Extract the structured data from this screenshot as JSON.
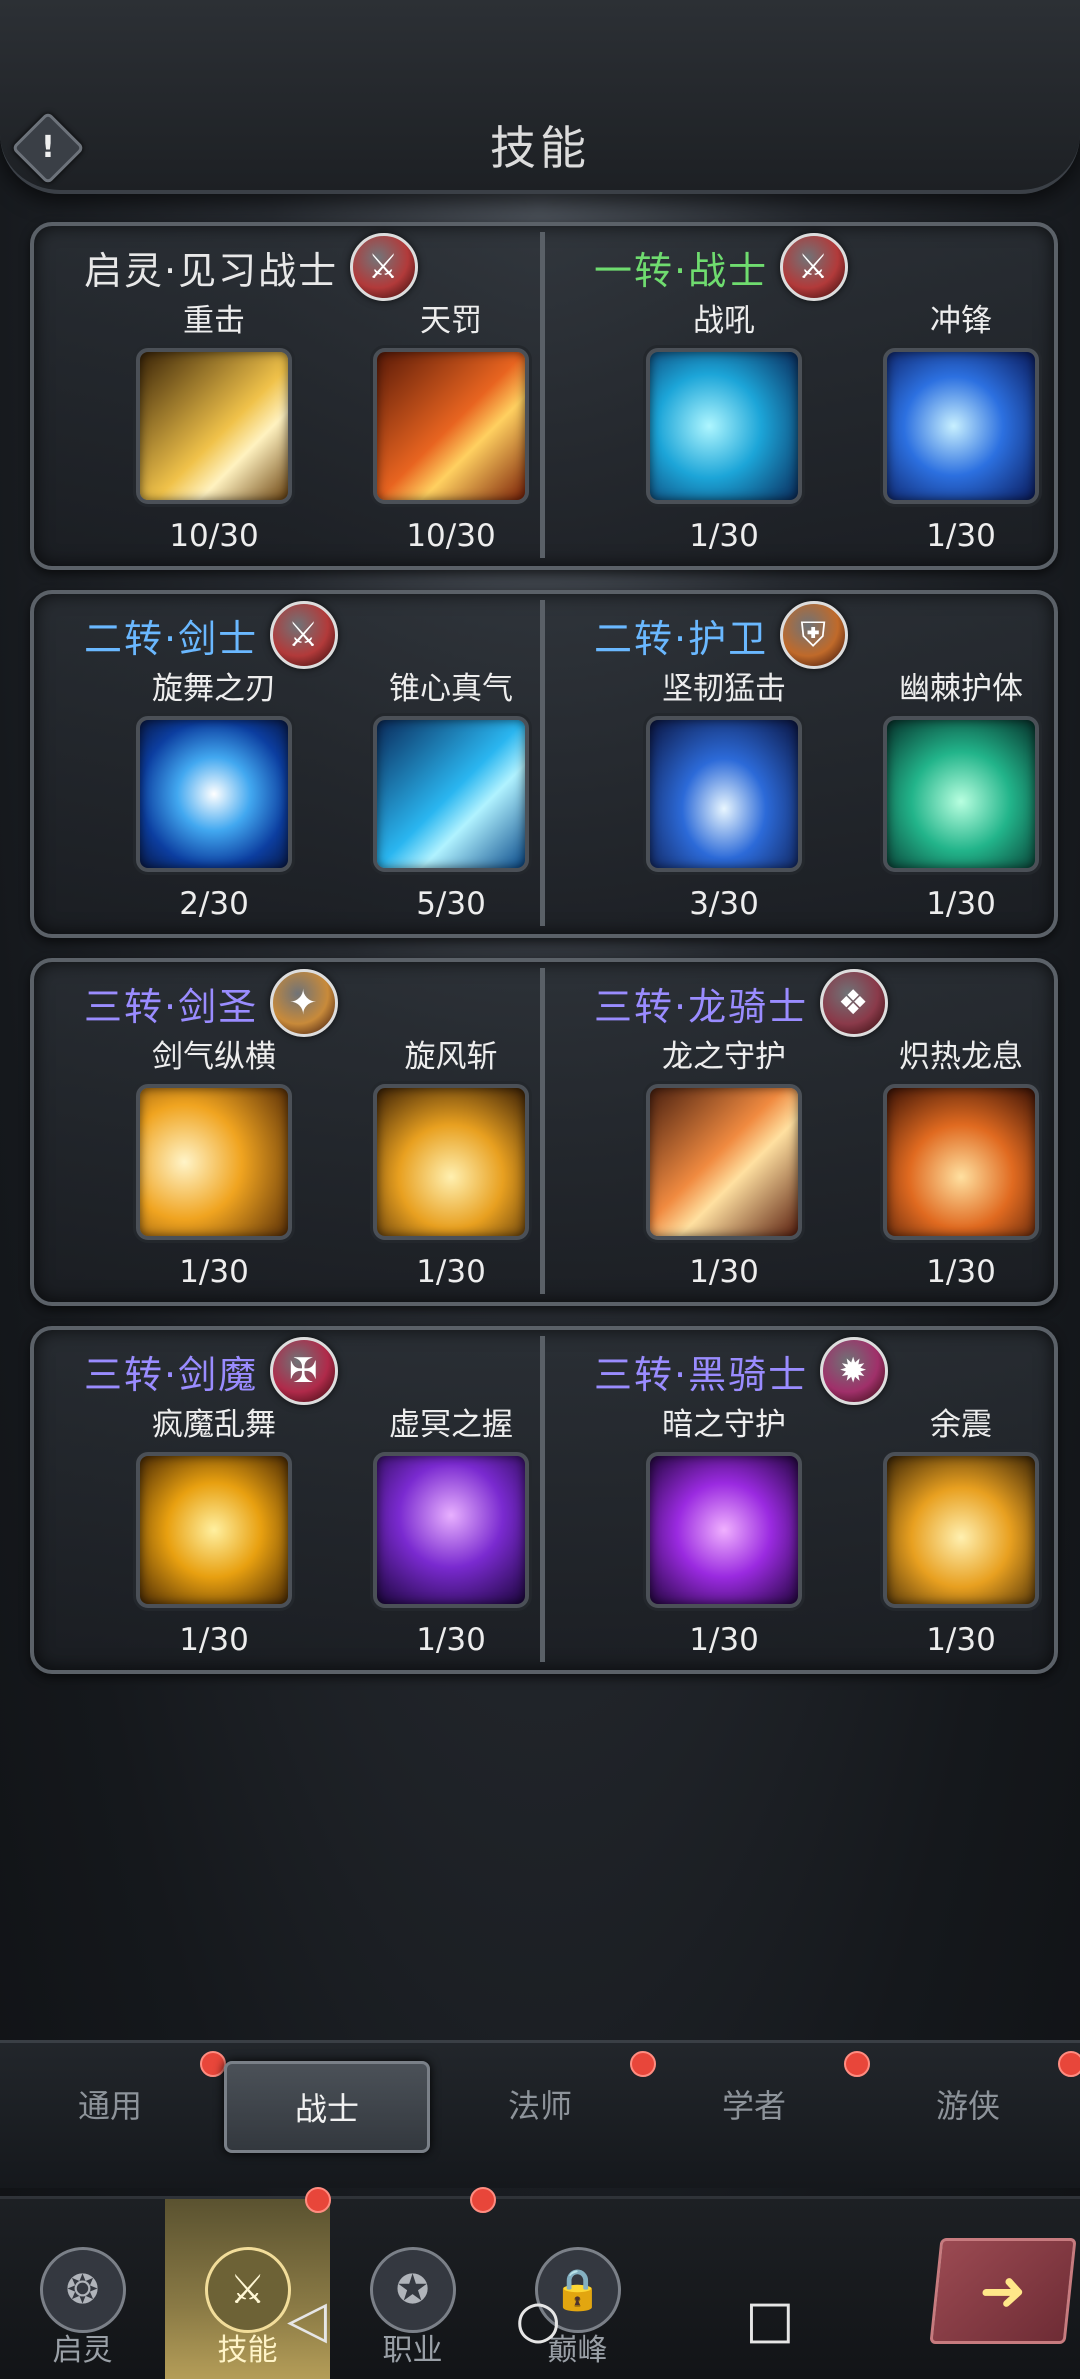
{
  "header": {
    "title": "技能",
    "info_icon": "!"
  },
  "panels": [
    {
      "left": {
        "title": "启灵·见习战士",
        "title_color": "#e8e8e8",
        "emblem": "sword-emblem-icon",
        "emblem_bg": "#b23a3a",
        "skills": [
          {
            "name": "重击",
            "level": "10/30",
            "gradient": "linear-gradient(135deg,#3a2408,#f0c24a 55%,#fff2c0 70%,#6b4310)"
          },
          {
            "name": "天罚",
            "level": "10/30",
            "gradient": "linear-gradient(135deg,#5a1a08,#e86420 50%,#ffd060 65%,#7a2008)"
          }
        ]
      },
      "right": {
        "title": "一转·战士",
        "title_color": "#6fdc6f",
        "emblem": "sword-emblem-icon",
        "emblem_bg": "#b23a3a",
        "skills": [
          {
            "name": "战吼",
            "level": "1/30",
            "gradient": "radial-gradient(circle at 40% 50%,#aef6ff,#1ca5d8 45%,#0a2a5a)"
          },
          {
            "name": "冲锋",
            "level": "1/30",
            "gradient": "radial-gradient(circle at 45% 50%,#c8f0ff,#2c70e0 45%,#0a1a5a)"
          }
        ]
      }
    },
    {
      "left": {
        "title": "二转·剑士",
        "title_color": "#6ab8ff",
        "emblem": "triple-sword-icon",
        "emblem_bg": "#b23a3a",
        "skills": [
          {
            "name": "旋舞之刃",
            "level": "2/30",
            "gradient": "radial-gradient(circle at 50% 50%,#ffffff,#42a8f0 35%,#0c3ea0 70%,#081a4a)"
          },
          {
            "name": "锥心真气",
            "level": "5/30",
            "gradient": "linear-gradient(135deg,#0a2a5a,#2ab6f0 50%,#b0f2ff 65%,#0a4a8a)"
          }
        ]
      },
      "right": {
        "title": "二转·护卫",
        "title_color": "#6ab8ff",
        "emblem": "shield-emblem-icon",
        "emblem_bg": "#c06a2a",
        "skills": [
          {
            "name": "坚韧猛击",
            "level": "3/30",
            "gradient": "radial-gradient(ellipse at 50% 60%,#e8f6ff,#2c6ad8 40%,#0a1440)"
          },
          {
            "name": "幽棘护体",
            "level": "1/30",
            "gradient": "radial-gradient(circle at 50% 55%,#b8ffe0,#22b48a 45%,#06302a)"
          }
        ]
      }
    },
    {
      "left": {
        "title": "三转·剑圣",
        "title_color": "#9a8cff",
        "emblem": "winged-sword-icon",
        "emblem_bg": "#c88a3a",
        "skills": [
          {
            "name": "剑气纵横",
            "level": "1/30",
            "gradient": "radial-gradient(circle at 30% 50%,#fff4c8,#f0a420 45%,#5a3008)"
          },
          {
            "name": "旋风斩",
            "level": "1/30",
            "gradient": "radial-gradient(circle at 50% 60%,#fff0b0,#e8a020 45%,#3a2006)"
          }
        ]
      },
      "right": {
        "title": "三转·龙骑士",
        "title_color": "#9a8cff",
        "emblem": "dragon-emblem-icon",
        "emblem_bg": "#8a3a4a",
        "skills": [
          {
            "name": "龙之守护",
            "level": "1/30",
            "gradient": "linear-gradient(135deg,#4a2010,#f08a40 45%,#ffe0a0 60%,#5a2010)"
          },
          {
            "name": "炽热龙息",
            "level": "1/30",
            "gradient": "radial-gradient(circle at 50% 60%,#ffe0a0,#e06a20 45%,#3a1206)"
          }
        ]
      }
    },
    {
      "left": {
        "title": "三转·剑魔",
        "title_color": "#9a8cff",
        "emblem": "cross-swords-icon",
        "emblem_bg": "#b02a4a",
        "skills": [
          {
            "name": "疯魔乱舞",
            "level": "1/30",
            "gradient": "radial-gradient(circle at 50% 50%,#fff0a0,#e8a010 45%,#4a2a04)"
          },
          {
            "name": "虚冥之握",
            "level": "1/30",
            "gradient": "radial-gradient(circle at 50% 40%,#e8b0ff,#7a2ad0 45%,#1a063a)"
          }
        ]
      },
      "right": {
        "title": "三转·黑骑士",
        "title_color": "#9a8cff",
        "emblem": "dark-knight-emblem-icon",
        "emblem_bg": "#a0306a",
        "skills": [
          {
            "name": "暗之守护",
            "level": "1/30",
            "gradient": "radial-gradient(circle at 50% 50%,#f0b0ff,#9a2ae0 45%,#22063e)"
          },
          {
            "name": "余震",
            "level": "1/30",
            "gradient": "radial-gradient(circle at 50% 55%,#fff0b0,#e8a020 45%,#3a2406)"
          }
        ]
      }
    }
  ],
  "tabs": [
    {
      "label": "通用",
      "has_dot": true
    },
    {
      "label": "战士",
      "has_dot": false,
      "active": true
    },
    {
      "label": "法师",
      "has_dot": true
    },
    {
      "label": "学者",
      "has_dot": true
    },
    {
      "label": "游侠",
      "has_dot": true
    }
  ],
  "bottom_nav": [
    {
      "label": "启灵",
      "icon": "spirit-icon",
      "active": false,
      "has_dot": false
    },
    {
      "label": "技能",
      "icon": "skill-icon",
      "active": true,
      "has_dot": true
    },
    {
      "label": "职业",
      "icon": "class-icon",
      "active": false,
      "has_dot": true
    },
    {
      "label": "巅峰",
      "icon": "locked-peak-icon",
      "active": false,
      "has_dot": false,
      "locked": true
    }
  ],
  "system_nav": {
    "back": "◁",
    "home": "○",
    "recents": "□"
  },
  "colors": {
    "badge": "#e8463a",
    "active_tab": "#4b5158",
    "gold_accent": "#f2dd9a"
  }
}
